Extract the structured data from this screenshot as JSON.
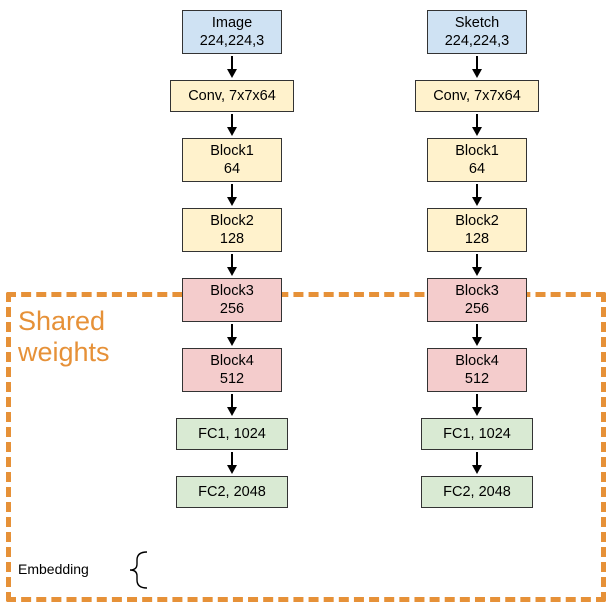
{
  "left": {
    "input_title": "Image",
    "input_dims": "224,224,3",
    "conv": "Conv, 7x7x64",
    "b1_name": "Block1",
    "b1_ch": "64",
    "b2_name": "Block2",
    "b2_ch": "128",
    "b3_name": "Block3",
    "b3_ch": "256",
    "b4_name": "Block4",
    "b4_ch": "512",
    "fc1": "FC1, 1024",
    "fc2": "FC2, 2048"
  },
  "right": {
    "input_title": "Sketch",
    "input_dims": "224,224,3",
    "conv": "Conv, 7x7x64",
    "b1_name": "Block1",
    "b1_ch": "64",
    "b2_name": "Block2",
    "b2_ch": "128",
    "b3_name": "Block3",
    "b3_ch": "256",
    "b4_name": "Block4",
    "b4_ch": "512",
    "fc1": "FC1, 1024",
    "fc2": "FC2, 2048"
  },
  "shared_label_l1": "Shared",
  "shared_label_l2": "weights",
  "embedding_label": "Embedding",
  "chart_data": {
    "type": "diagram",
    "title": "Siamese / two-branch CNN architecture with shared weights",
    "branches": [
      {
        "name": "Image",
        "input_shape": [
          224,
          224,
          3
        ],
        "layers": [
          {
            "name": "Conv",
            "kernel": "7x7",
            "channels": 64,
            "shared": false
          },
          {
            "name": "Block1",
            "channels": 64,
            "shared": false
          },
          {
            "name": "Block2",
            "channels": 128,
            "shared": false
          },
          {
            "name": "Block3",
            "channels": 256,
            "shared": true
          },
          {
            "name": "Block4",
            "channels": 512,
            "shared": true
          },
          {
            "name": "FC1",
            "units": 1024,
            "shared": true
          },
          {
            "name": "FC2",
            "units": 2048,
            "shared": true,
            "role": "Embedding"
          }
        ]
      },
      {
        "name": "Sketch",
        "input_shape": [
          224,
          224,
          3
        ],
        "layers": [
          {
            "name": "Conv",
            "kernel": "7x7",
            "channels": 64,
            "shared": false
          },
          {
            "name": "Block1",
            "channels": 64,
            "shared": false
          },
          {
            "name": "Block2",
            "channels": 128,
            "shared": false
          },
          {
            "name": "Block3",
            "channels": 256,
            "shared": true
          },
          {
            "name": "Block4",
            "channels": 512,
            "shared": true
          },
          {
            "name": "FC1",
            "units": 1024,
            "shared": true
          },
          {
            "name": "FC2",
            "units": 2048,
            "shared": true,
            "role": "Embedding"
          }
        ]
      }
    ],
    "shared_region": [
      "Block3",
      "Block4",
      "FC1",
      "FC2"
    ],
    "annotations": [
      "Shared weights",
      "Embedding"
    ]
  }
}
